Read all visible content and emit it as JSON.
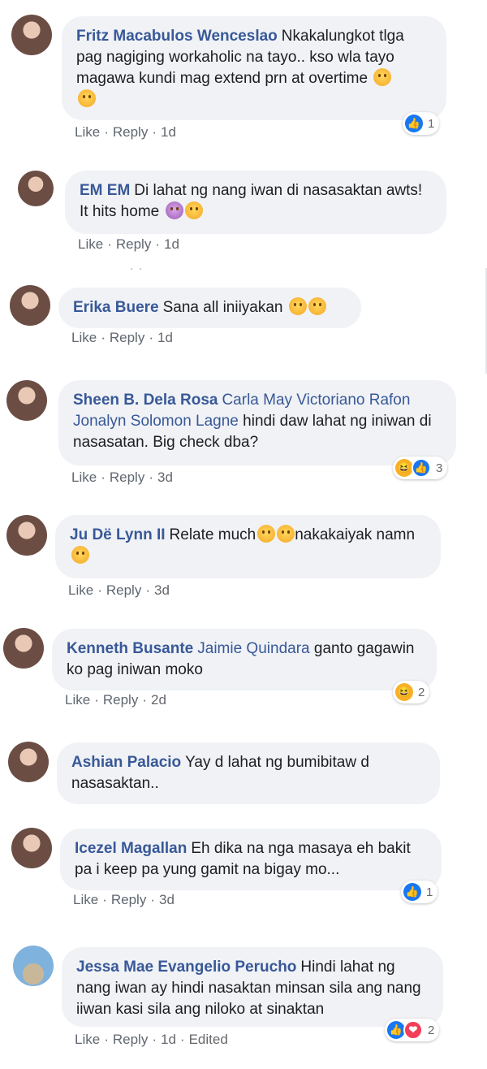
{
  "comments": [
    {
      "author": "Fritz Macabulos Wenceslao",
      "tags": "",
      "text": "Nkakalungkot tlga pag nagiging workaholic na tayo.. kso wla tayo magawa kundi mag extend prn at overtime",
      "like": "Like",
      "reply": "Reply",
      "time": "1d",
      "reactions": [
        "like"
      ],
      "reaction_count": "1"
    },
    {
      "author": "EM EM",
      "tags": "",
      "text": "Di lahat ng nang iwan di nasasaktan awts! It hits home",
      "like": "Like",
      "reply": "Reply",
      "time": "1d",
      "reactions": [],
      "reaction_count": ""
    },
    {
      "author": "Erika Buere",
      "tags": "",
      "text": "Sana all iniiyakan",
      "like": "Like",
      "reply": "Reply",
      "time": "1d",
      "reactions": [],
      "reaction_count": ""
    },
    {
      "author": "Sheen B. Dela Rosa",
      "tags": "Carla May Victoriano Rafon Jonalyn Solomon Lagne",
      "text": "hindi daw lahat ng iniwan di nasasatan. Big check dba?",
      "like": "Like",
      "reply": "Reply",
      "time": "3d",
      "reactions": [
        "haha",
        "like"
      ],
      "reaction_count": "3"
    },
    {
      "author": "Ju Dë Lynn II",
      "tags": "",
      "text": "Relate much",
      "text2": "nakakaiyak namn",
      "like": "Like",
      "reply": "Reply",
      "time": "3d",
      "reactions": [],
      "reaction_count": ""
    },
    {
      "author": "Kenneth Busante",
      "tags": "Jaimie Quindara",
      "text": "ganto gagawin ko pag iniwan moko",
      "like": "Like",
      "reply": "Reply",
      "time": "2d",
      "reactions": [
        "haha"
      ],
      "reaction_count": "2"
    },
    {
      "author": "Ashian Palacio",
      "tags": "",
      "text": "Yay d lahat ng bumibitaw d nasasaktan..",
      "like": "",
      "reply": "",
      "time": "",
      "reactions": [],
      "reaction_count": ""
    },
    {
      "author": "Icezel Magallan",
      "tags": "",
      "text": "Eh dika na nga masaya eh bakit pa i keep pa yung gamit na bigay mo...",
      "like": "Like",
      "reply": "Reply",
      "time": "3d",
      "reactions": [
        "like"
      ],
      "reaction_count": "1"
    },
    {
      "author": "Jessa Mae Evangelio Perucho",
      "tags": "",
      "text": "Hindi lahat ng nang iwan ay hindi nasaktan minsan sila ang nang iiwan kasi sila ang niloko at sinaktan",
      "like": "Like",
      "reply": "Reply",
      "time": "1d",
      "edited": "Edited",
      "reactions": [
        "like",
        "love"
      ],
      "reaction_count": "2"
    }
  ],
  "icons": {
    "like": "👍",
    "haha": "😆",
    "love": "❤"
  },
  "colors": {
    "author": "#385898",
    "bubble": "#f0f2f5",
    "meta": "#65676b",
    "like_blue": "#1877f2"
  }
}
